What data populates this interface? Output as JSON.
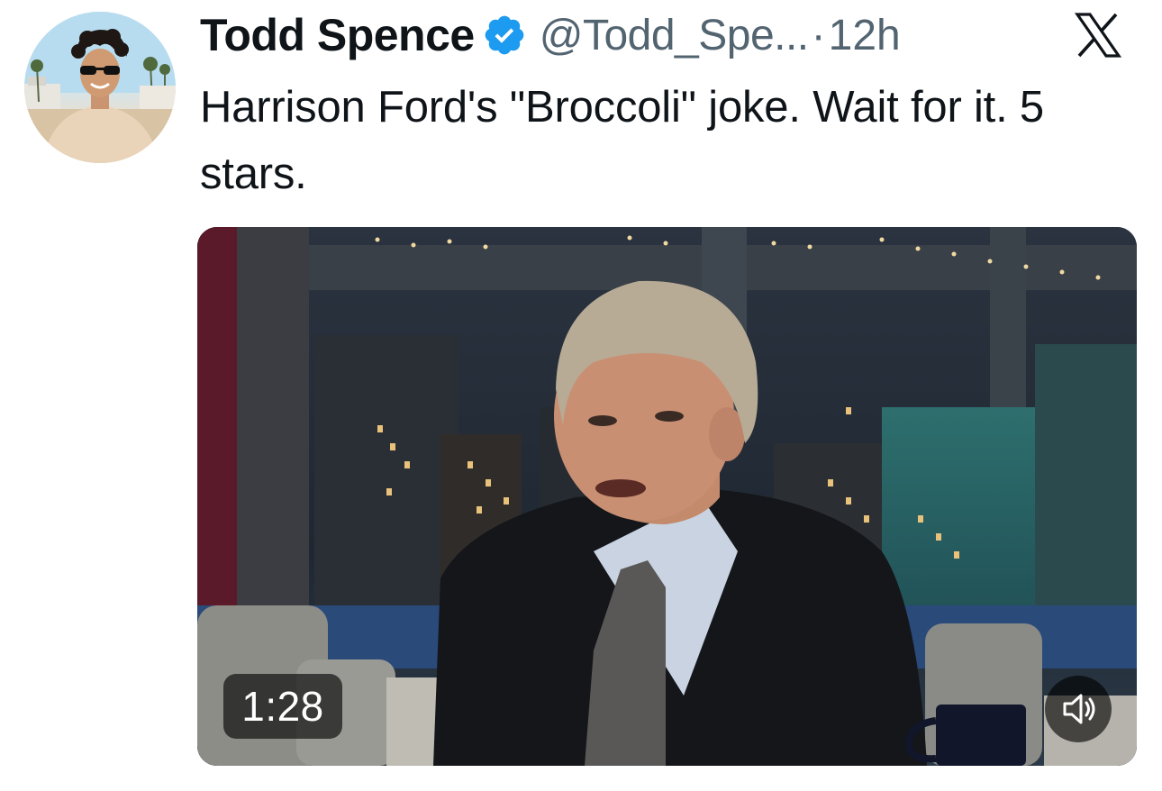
{
  "author": {
    "display_name": "Todd Spence",
    "handle": "@Todd_Spe...",
    "separator": "·",
    "time": "12h",
    "verified_icon": "verified-badge-icon",
    "verified_color": "#1d9bf0"
  },
  "platform": {
    "logo_icon": "x-logo-icon"
  },
  "tweet": {
    "text": "Harrison Ford's \"Broccoli\" joke. Wait for it. 5 stars."
  },
  "media": {
    "type": "video",
    "duration": "1:28",
    "mute_icon": "speaker-muted-icon"
  },
  "colors": {
    "primary_text": "#0f1419",
    "secondary_text": "#536471"
  }
}
